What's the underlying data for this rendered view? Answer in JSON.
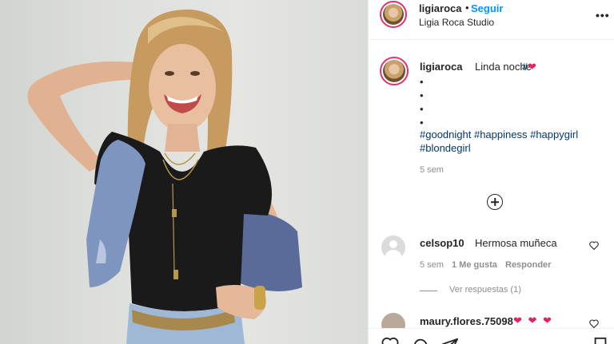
{
  "header": {
    "username": "ligiaroca",
    "dot": "•",
    "follow_label": "Seguir",
    "location": "Ligia Roca Studio",
    "more_label": "•••"
  },
  "caption": {
    "username": "ligiaroca",
    "text": "Linda noche",
    "hashtag_symbol": "#",
    "heart": "❤",
    "bullets": [
      "•",
      "•",
      "•",
      "•"
    ],
    "hashtags_line1": [
      "#goodnight",
      "#happiness",
      "#happygirl"
    ],
    "hashtags_line2": "#blondegirl",
    "time": "5 sem"
  },
  "load_more": {
    "icon": "plus-circle-icon"
  },
  "comments": [
    {
      "username": "celsop10",
      "text": "Hermosa muñeca",
      "time": "5 sem",
      "likes": "1 Me gusta",
      "reply_label": "Responder",
      "view_replies": "Ver respuestas (1)"
    },
    {
      "username": "maury.flores.75098",
      "text": "❤ ❤ ❤"
    }
  ],
  "colors": {
    "accent": "#0095f6",
    "hashtag": "#00376b",
    "heart": "#e0245e",
    "muted": "#8e8e8e"
  },
  "actions": {
    "icons": [
      "heart-outline-icon",
      "comment-icon",
      "share-icon",
      "bookmark-icon"
    ]
  }
}
